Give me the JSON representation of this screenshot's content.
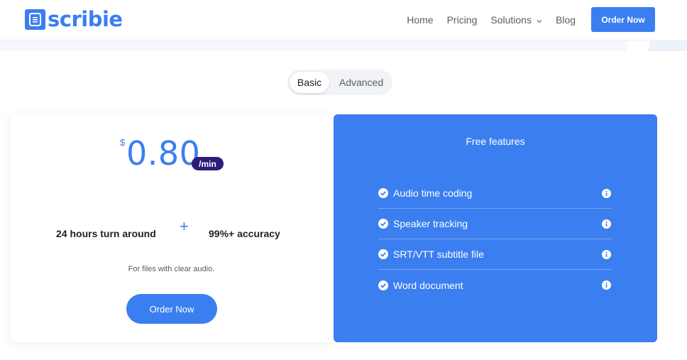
{
  "header": {
    "logo_text": "scribie",
    "nav": {
      "home": "Home",
      "pricing": "Pricing",
      "solutions": "Solutions",
      "blog": "Blog"
    },
    "order_button": "Order Now"
  },
  "plan_toggle": {
    "basic": "Basic",
    "advanced": "Advanced",
    "selected": "Basic"
  },
  "pricing_card": {
    "currency": "$",
    "price": "0.80",
    "unit": "/min",
    "turnaround": "24 hours turn around",
    "plus": "+",
    "accuracy": "99%+ accuracy",
    "note": "For files with clear audio.",
    "order_button": "Order Now"
  },
  "free_features": {
    "title": "Free features",
    "items": [
      {
        "label": "Audio time coding"
      },
      {
        "label": "Speaker tracking"
      },
      {
        "label": "SRT/VTT subtitle file"
      },
      {
        "label": "Word document"
      }
    ]
  },
  "colors": {
    "brand_blue": "#3b7ef0",
    "badge_purple": "#2d1d77"
  }
}
